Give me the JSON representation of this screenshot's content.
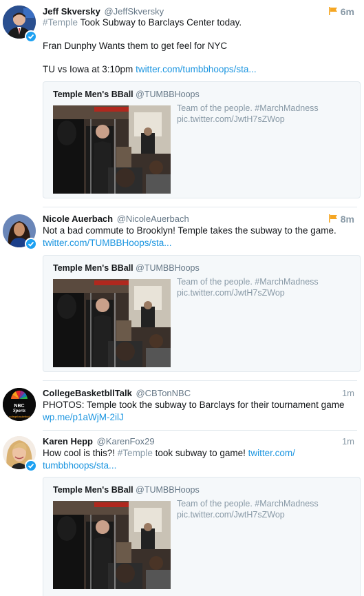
{
  "tweets": [
    {
      "name": "Jeff Skversky",
      "handle": "@JeffSkversky",
      "time": "6m",
      "hashtag": "#Temple",
      "text_line1": " Took Subway to Barclays Center today.",
      "text_line2": "Fran Dunphy Wants them to get feel for NYC",
      "text_line3_pre": "TU vs Iowa at 3:10pm ",
      "link": "twitter.com/tumbbhoops/sta...",
      "quote": {
        "name": "Temple Men's BBall",
        "handle": "@TUMBBHoops",
        "text": "Team of the people. #MarchMadness pic.twitter.com/JwtH7sZWop"
      }
    },
    {
      "name": "Nicole Auerbach",
      "handle": "@NicoleAuerbach",
      "time": "8m",
      "text": "Not a bad commute to Brooklyn! Temple takes the subway to the game.",
      "link": "twitter.com/TUMBBHoops/sta...",
      "quote": {
        "name": "Temple Men's BBall",
        "handle": "@TUMBBHoops",
        "text": "Team of the people. #MarchMadness pic.twitter.com/JwtH7sZWop"
      }
    },
    {
      "name": "CollegeBasketbllTalk",
      "handle": "@CBTonNBC",
      "time": "1m",
      "text": "PHOTOS: Temple took the subway to Barclays for their tournament game",
      "link": "wp.me/p1aWjM-2ilJ",
      "avatar_text_top": "NBC",
      "avatar_text_mid": "Sports",
      "avatar_text_bottom": "collegebasketball"
    },
    {
      "name": "Karen Hepp",
      "handle": "@KarenFox29",
      "time": "1m",
      "text_pre": "How cool is this?! ",
      "hashtag": "#Temple",
      "text_post": " took subway to game!  ",
      "link_line1": "twitter.com/",
      "link_line2": "tumbbhoops/sta...",
      "quote": {
        "name": "Temple Men's BBall",
        "handle": "@TUMBBHoops",
        "text": "Team of the people. #MarchMadness pic.twitter.com/JwtH7sZWop"
      }
    }
  ],
  "colors": {
    "link": "#1b95e0",
    "hashtag": "#8899a6",
    "verified": "#1da1f2",
    "flag": "#f5a623"
  }
}
